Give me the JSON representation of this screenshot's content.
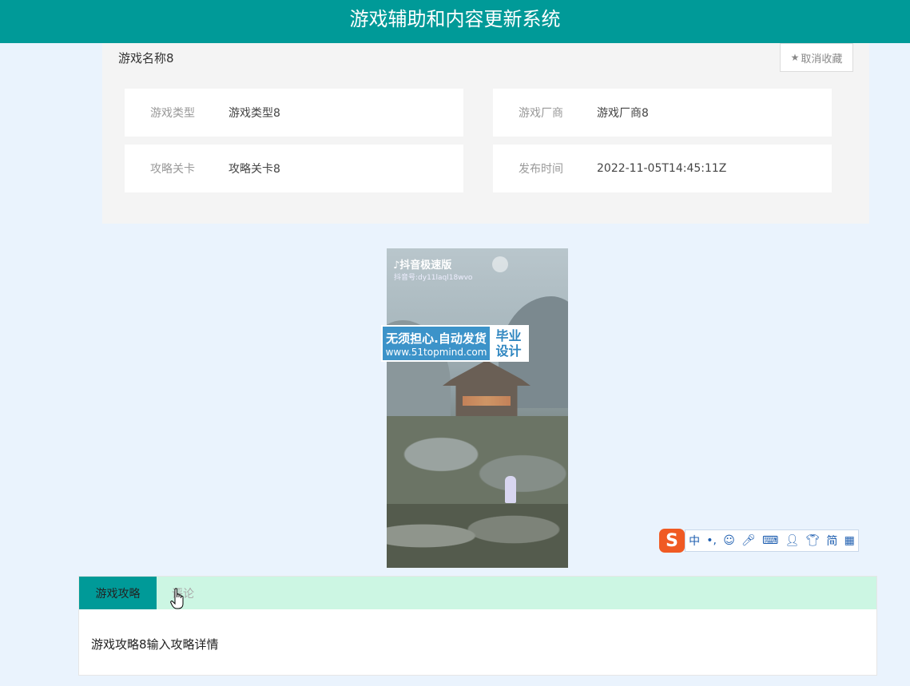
{
  "header": {
    "title": "游戏辅助和内容更新系统"
  },
  "game": {
    "name": "游戏名称8",
    "favorite_button": "取消收藏",
    "fields": [
      {
        "label": "游戏类型",
        "value": "游戏类型8"
      },
      {
        "label": "游戏厂商",
        "value": "游戏厂商8"
      },
      {
        "label": "攻略关卡",
        "value": "攻略关卡8"
      },
      {
        "label": "发布时间",
        "value": "2022-11-05T14:45:11Z"
      }
    ]
  },
  "media": {
    "app_label": "抖音极速版",
    "account_id": "抖音号:dy11laql18wvo"
  },
  "watermark": {
    "line1": "无须担心.自动发货",
    "line2": "www.51topmind.com",
    "badge_line1": "毕业",
    "badge_line2": "设计"
  },
  "ime": {
    "logo": "S",
    "mode": "中",
    "punct": "•,",
    "simplified": "简"
  },
  "tabs": {
    "items": [
      {
        "label": "游戏攻略"
      },
      {
        "label": "评论"
      }
    ],
    "content": "游戏攻略8输入攻略详情"
  },
  "icons": {
    "favorite": "star-icon",
    "cursor": "hand-pointer-icon"
  },
  "colors": {
    "header": "#009a98",
    "page_bg": "#eaf3fd",
    "tab_bar": "#ccf6e3",
    "ime_logo": "#f05a23"
  }
}
